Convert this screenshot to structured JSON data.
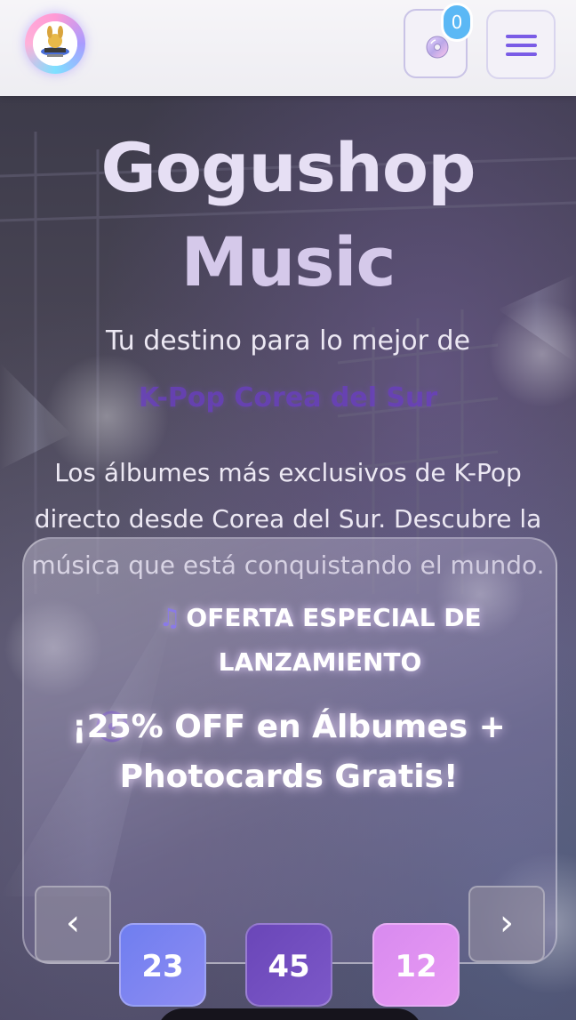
{
  "header": {
    "cart_count": "0",
    "icons": {
      "logo": "gogushop-logo",
      "cart": "cd-disc-icon",
      "menu": "hamburger-menu-icon"
    }
  },
  "hero": {
    "title_line1": "Gogushop",
    "title_line2": "Music",
    "tagline": "Tu destino para lo mejor de",
    "highlight": "K-Pop Corea del Sur",
    "description": "Los álbumes más exclusivos de K-Pop directo desde Corea del Sur. Descubre la música que está conquistando el mundo."
  },
  "promo": {
    "label": "OFERTA ESPECIAL DE LANZAMIENTO",
    "label_icon": "music-note-icon",
    "headline": "¡25% OFF en Álbumes + Photocards Gratis!",
    "prev_label": "‹",
    "next_label": "›",
    "countdown": {
      "days": "23",
      "hours": "45",
      "minutes": "12"
    }
  },
  "colors": {
    "accent": "#7a5ce6",
    "badge": "#5bb8f5",
    "highlight": "#6a3fc2"
  }
}
